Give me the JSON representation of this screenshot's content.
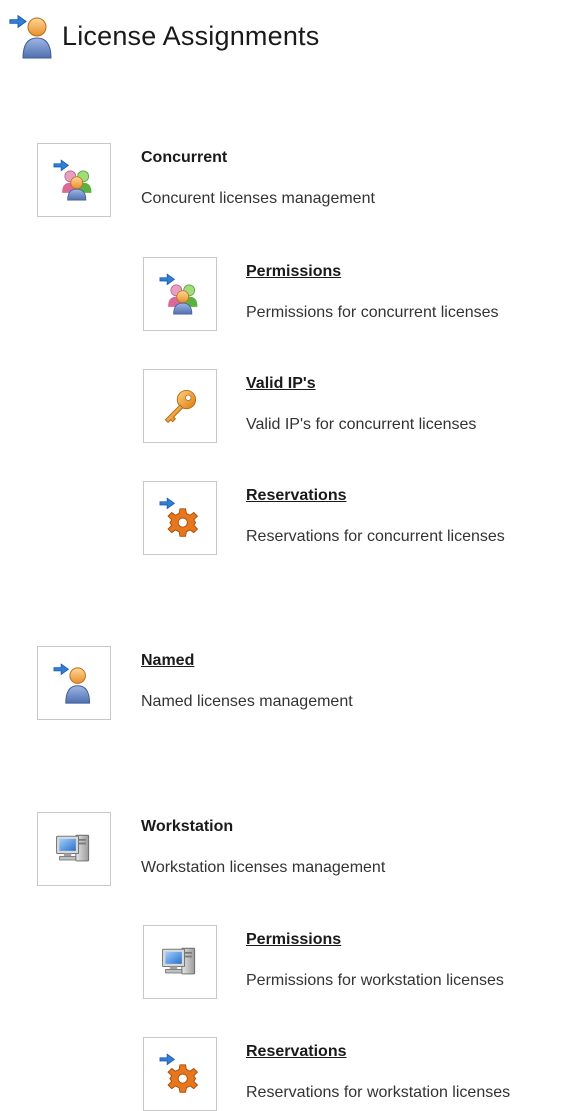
{
  "page": {
    "title": "License Assignments",
    "title_icon": "user-arrow-icon"
  },
  "sections": {
    "concurrent": {
      "title": "Concurrent",
      "description": "Concurent licenses management",
      "icon": "group-arrow-icon",
      "children": {
        "permissions": {
          "title": "Permissions",
          "description": "Permissions for concurrent licenses",
          "icon": "group-arrow-icon"
        },
        "valid_ips": {
          "title": "Valid IP's",
          "description": "Valid IP's for concurrent licenses",
          "icon": "key-icon"
        },
        "reservations": {
          "title": "Reservations",
          "description": "Reservations for concurrent licenses",
          "icon": "gear-arrow-icon"
        }
      }
    },
    "named": {
      "title": "Named",
      "description": "Named licenses management",
      "icon": "user-arrow-icon"
    },
    "workstation": {
      "title": "Workstation",
      "description": "Workstation licenses management",
      "icon": "computer-icon",
      "children": {
        "permissions": {
          "title": "Permissions",
          "description": "Permissions for workstation licenses",
          "icon": "computer-icon"
        },
        "reservations": {
          "title": "Reservations",
          "description": "Reservations for workstation licenses",
          "icon": "gear-arrow-icon"
        }
      }
    }
  },
  "colors": {
    "arrow_blue": "#2f7fd8",
    "person_orange": "#f0a040",
    "person_blue": "#6f8fc8",
    "key_orange": "#e9962a",
    "gear_orange": "#e8761c"
  }
}
